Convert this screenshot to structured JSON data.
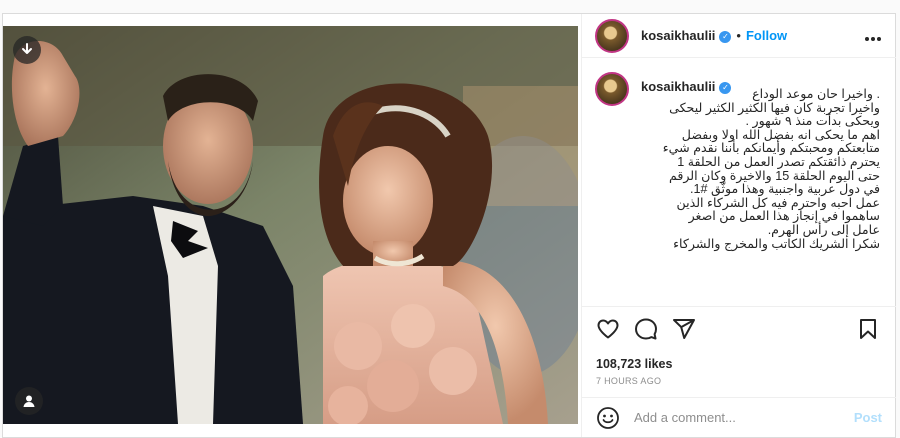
{
  "user": {
    "username": "kosaikhaulii",
    "verified_mark": "✓",
    "follow_label": "Follow",
    "separator": "•"
  },
  "caption": {
    "username": "kosaikhaulii",
    "text": ". واخيرا حان موعد الوداع\nواخيرا تجربة كان فيها الكثير الكثير ليحكى\nويحكى بدأت منذ ٩ شهور .\nاهم ما يحكى انه بفضل الله اولا وبفضل\nمتابعتكم ومحبتكم وأيمانكم بأننا نقدم شيء\nيحترم ذائقتكم تصدر العمل من الحلقة 1\nحتى اليوم الحلقة 15 والاخيرة وكان الرقم\nفي دول عربية واجنبية وهذا موثّق #1.\nعمل احبه واحترم فيه كل الشركاء الذين\nساهموا في إنجاز هذا العمل من اصغر\nعامل إلى رأس الهرم.\nشكرا الشريك الكاتب والمخرج والشركاء"
  },
  "stats": {
    "likes": "108,723 likes",
    "time_ago": "7 HOURS AGO"
  },
  "comment": {
    "placeholder": "Add a comment...",
    "post_label": "Post"
  },
  "icons": {
    "media": [
      "download-icon",
      "user-tag-icon"
    ],
    "actions": [
      "heart-icon",
      "comment-icon",
      "share-icon",
      "bookmark-icon"
    ],
    "header": [
      "more-icon"
    ],
    "comment": [
      "emoji-icon"
    ]
  },
  "colors": {
    "link": "#0095f6",
    "verified": "#3897f0",
    "muted": "#8e8e8e",
    "post_disabled": "#b2dffc"
  }
}
